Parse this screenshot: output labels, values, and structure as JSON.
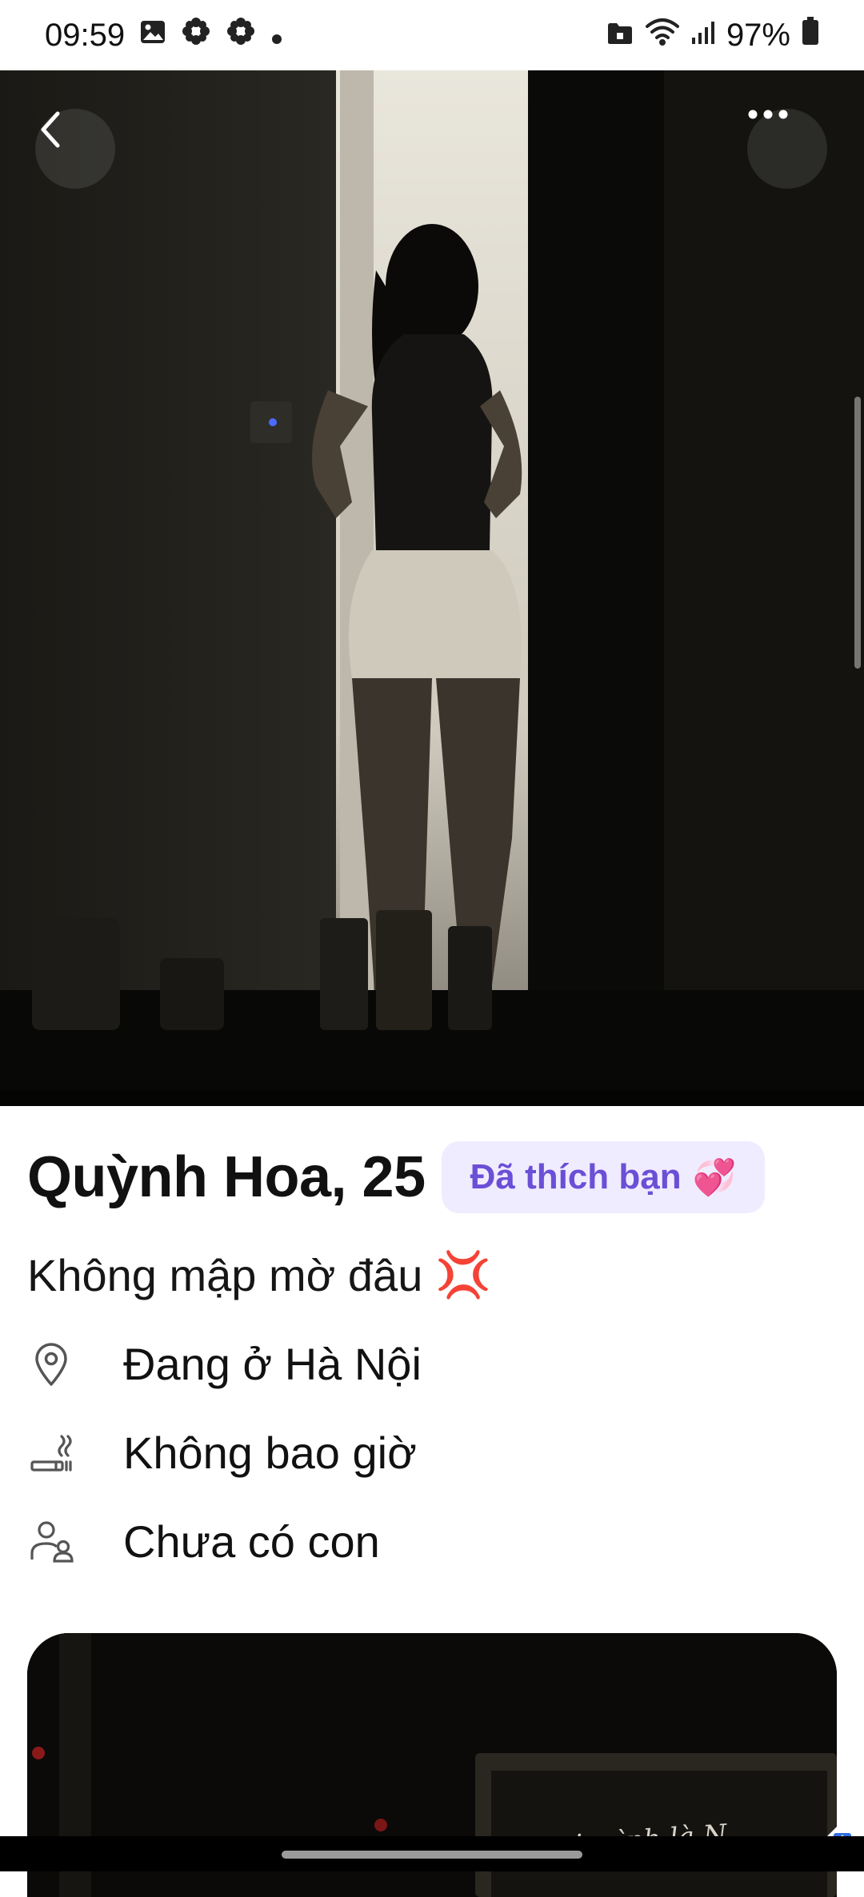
{
  "status_bar": {
    "time": "09:59",
    "battery": "97%",
    "left_icons": [
      "image-icon",
      "flower-icon",
      "flower-icon",
      "dot-icon"
    ],
    "right_icons": [
      "lock-folder-icon",
      "wifi-icon",
      "signal-icon",
      "battery-icon"
    ]
  },
  "header": {
    "back_icon": "chevron-left-icon",
    "more_icon": "more-horizontal-icon"
  },
  "profile": {
    "name_age": "Quỳnh Hoa, 25",
    "liked_badge": "Đã thích bạn",
    "liked_emoji": "💞",
    "bio": "Không mập mờ đâu",
    "bio_emoji": "💢",
    "details": [
      {
        "icon": "location-pin-icon",
        "text": "Đang ở Hà Nội"
      },
      {
        "icon": "smoking-icon",
        "text": "Không bao giờ"
      },
      {
        "icon": "children-icon",
        "text": "Chưa có con"
      }
    ]
  },
  "second_photo": {
    "caption_visible": "-mi mình là N"
  },
  "colors": {
    "accent": "#6b4fd6",
    "badge_bg": "#f0ecff",
    "photo_bg": "#0b0a08"
  }
}
